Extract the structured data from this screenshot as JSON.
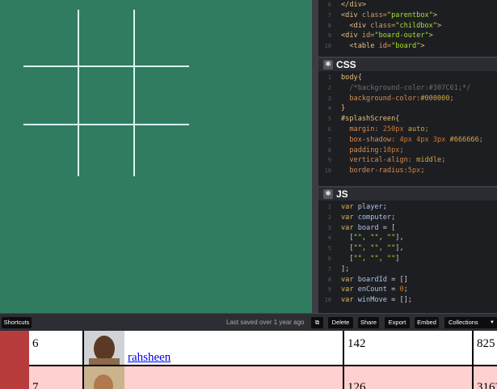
{
  "html_pane": {
    "lines": [
      {
        "n": "6",
        "parts": [
          {
            "c": "tag",
            "t": "</div>"
          }
        ]
      },
      {
        "n": "7",
        "parts": [
          {
            "c": "tag",
            "t": "<div "
          },
          {
            "c": "attr",
            "t": "class="
          },
          {
            "c": "str",
            "t": "\"parentbox\""
          },
          {
            "c": "tag",
            "t": ">"
          }
        ]
      },
      {
        "n": "8",
        "parts": [
          {
            "c": "tag",
            "t": "  <div "
          },
          {
            "c": "attr",
            "t": "class="
          },
          {
            "c": "str",
            "t": "\"childbox\""
          },
          {
            "c": "tag",
            "t": ">"
          }
        ]
      },
      {
        "n": "9",
        "parts": [
          {
            "c": "tag",
            "t": "<div "
          },
          {
            "c": "attr",
            "t": "id="
          },
          {
            "c": "str",
            "t": "\"board-outer\""
          },
          {
            "c": "tag",
            "t": ">"
          }
        ]
      },
      {
        "n": "10",
        "parts": [
          {
            "c": "tag",
            "t": "  <table "
          },
          {
            "c": "attr",
            "t": "id="
          },
          {
            "c": "str",
            "t": "\"board\""
          },
          {
            "c": "tag",
            "t": ">"
          }
        ]
      }
    ]
  },
  "css_pane": {
    "title": "CSS",
    "lines": [
      {
        "n": "1",
        "parts": [
          {
            "c": "sel",
            "t": "body{"
          }
        ]
      },
      {
        "n": "2",
        "parts": [
          {
            "c": "cmt",
            "t": "  /*background-color:#307C61;*/"
          }
        ]
      },
      {
        "n": "3",
        "parts": [
          {
            "c": "prop",
            "t": "  background-color:"
          },
          {
            "c": "val",
            "t": "#000000;"
          }
        ]
      },
      {
        "n": "4",
        "parts": [
          {
            "c": "sel",
            "t": "}"
          }
        ]
      },
      {
        "n": "5",
        "parts": [
          {
            "c": "sel",
            "t": "#splashScreen{"
          }
        ]
      },
      {
        "n": "6",
        "parts": [
          {
            "c": "prop",
            "t": "  margin: "
          },
          {
            "c": "num",
            "t": "250px"
          },
          {
            "c": "val",
            "t": " auto;"
          }
        ]
      },
      {
        "n": "7",
        "parts": [
          {
            "c": "prop",
            "t": "  box-shadow: "
          },
          {
            "c": "num",
            "t": "4px 4px 3px"
          },
          {
            "c": "val",
            "t": " #666666;"
          }
        ]
      },
      {
        "n": "8",
        "parts": [
          {
            "c": "prop",
            "t": "  padding:"
          },
          {
            "c": "num",
            "t": "10px"
          },
          {
            "c": "val",
            "t": ";"
          }
        ]
      },
      {
        "n": "9",
        "parts": [
          {
            "c": "prop",
            "t": "  vertical-align: "
          },
          {
            "c": "val",
            "t": "middle;"
          }
        ]
      },
      {
        "n": "10",
        "parts": [
          {
            "c": "prop",
            "t": "  border-radius:"
          },
          {
            "c": "num",
            "t": "5px"
          },
          {
            "c": "val",
            "t": ";"
          }
        ]
      }
    ]
  },
  "js_pane": {
    "title": "JS",
    "lines": [
      {
        "n": "1",
        "parts": [
          {
            "c": "kw",
            "t": "var "
          },
          {
            "c": "var",
            "t": "player"
          },
          {
            "c": "txt",
            "t": ";"
          }
        ]
      },
      {
        "n": "2",
        "parts": [
          {
            "c": "kw",
            "t": "var "
          },
          {
            "c": "var",
            "t": "computer"
          },
          {
            "c": "txt",
            "t": ";"
          }
        ]
      },
      {
        "n": "3",
        "parts": [
          {
            "c": "kw",
            "t": "var "
          },
          {
            "c": "var",
            "t": "board"
          },
          {
            "c": "txt",
            "t": " = ["
          }
        ]
      },
      {
        "n": "4",
        "parts": [
          {
            "c": "txt",
            "t": "  ["
          },
          {
            "c": "str",
            "t": "\"\", \"\", \"\""
          },
          {
            "c": "txt",
            "t": "],"
          }
        ]
      },
      {
        "n": "5",
        "parts": [
          {
            "c": "txt",
            "t": "  ["
          },
          {
            "c": "str",
            "t": "\"\", \"\", \"\""
          },
          {
            "c": "txt",
            "t": "],"
          }
        ]
      },
      {
        "n": "6",
        "parts": [
          {
            "c": "txt",
            "t": "  ["
          },
          {
            "c": "str",
            "t": "\"\", \"\", \"\""
          },
          {
            "c": "txt",
            "t": "]"
          }
        ]
      },
      {
        "n": "7",
        "parts": [
          {
            "c": "txt",
            "t": "];"
          }
        ]
      },
      {
        "n": "8",
        "parts": [
          {
            "c": "kw",
            "t": "var "
          },
          {
            "c": "var",
            "t": "boardId"
          },
          {
            "c": "txt",
            "t": " = []"
          }
        ]
      },
      {
        "n": "9",
        "parts": [
          {
            "c": "kw",
            "t": "var "
          },
          {
            "c": "var",
            "t": "enCount"
          },
          {
            "c": "txt",
            "t": " = "
          },
          {
            "c": "num",
            "t": "0"
          },
          {
            "c": "txt",
            "t": ";"
          }
        ]
      },
      {
        "n": "10",
        "parts": [
          {
            "c": "kw",
            "t": "var "
          },
          {
            "c": "var",
            "t": "winMove"
          },
          {
            "c": "txt",
            "t": " = [];"
          }
        ]
      }
    ]
  },
  "toolbar": {
    "shortcuts": "Shortcuts",
    "saved": "Last saved over 1 year ago",
    "delete": "Delete",
    "share": "Share",
    "export": "Export",
    "embed": "Embed",
    "collections": "Collections"
  },
  "table": {
    "rows": [
      {
        "rank": "6",
        "name": "rahsheen",
        "score": "142",
        "total": "825",
        "bg": "#ffffff"
      },
      {
        "rank": "7",
        "name": "",
        "score": "126",
        "total": "3163",
        "bg": "#ffd0d0"
      }
    ]
  },
  "colors": {
    "preview_bg": "#307c61",
    "grid_line": "#d8f6ee"
  }
}
